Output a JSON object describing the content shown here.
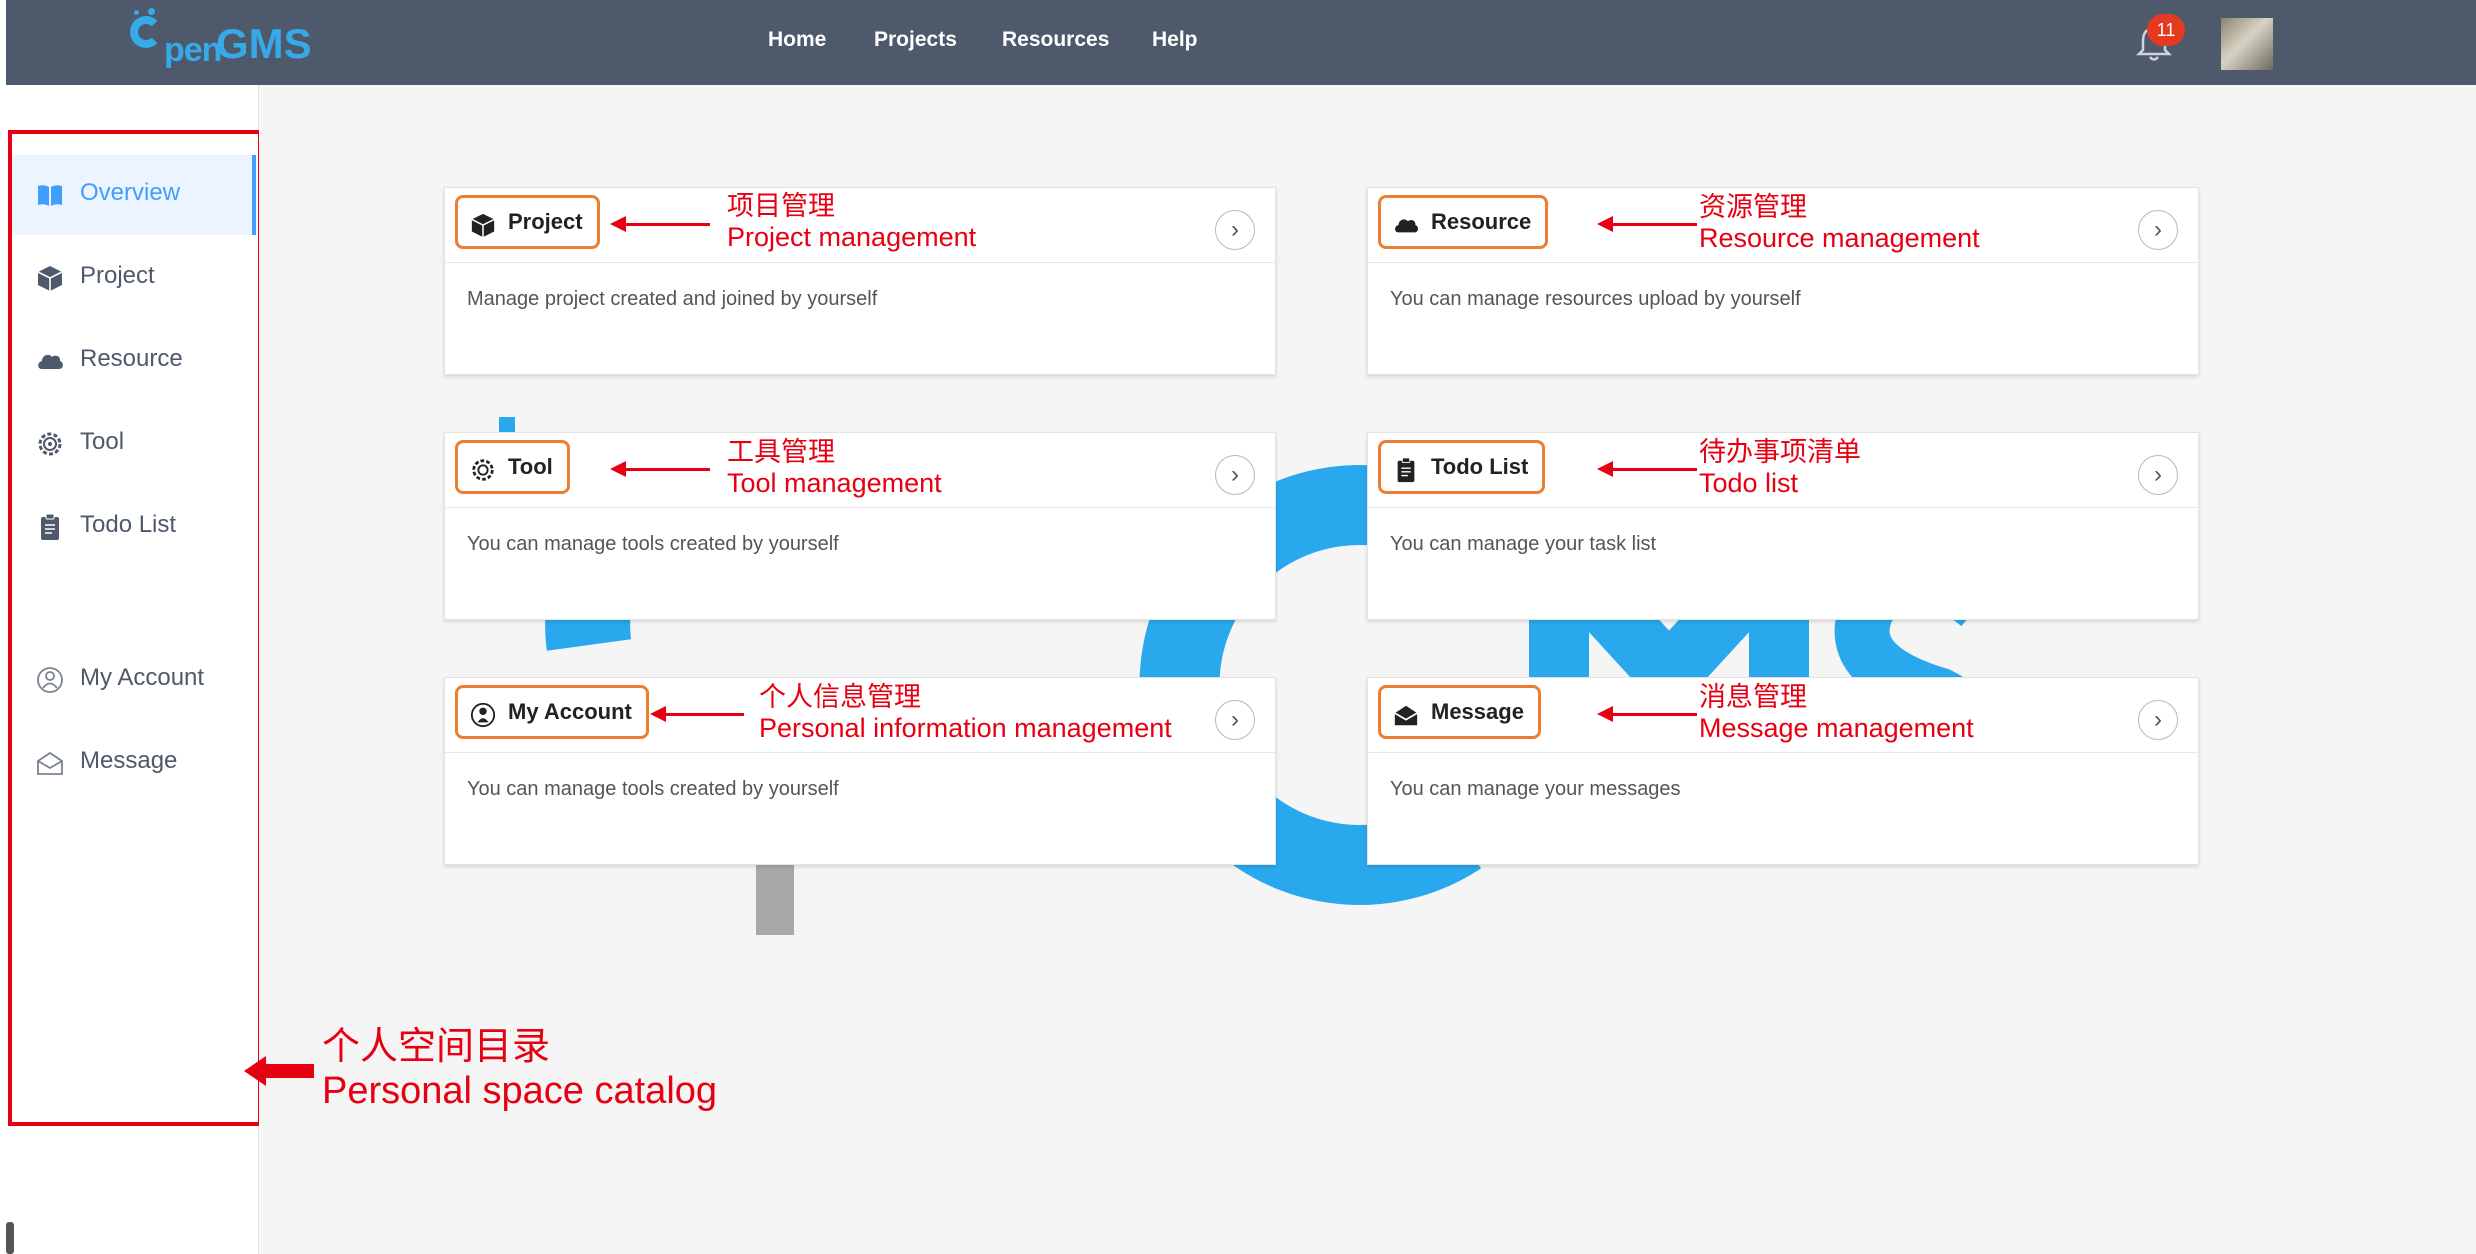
{
  "brand": {
    "logo_o": "O",
    "logo_pen": "pen",
    "logo_gms": "GMS",
    "accent": "#36a9e8"
  },
  "nav": {
    "links": [
      "Home",
      "Projects",
      "Resources",
      "Help"
    ],
    "notification_count": "11"
  },
  "sidebar": {
    "items": [
      {
        "label": "Overview",
        "icon": "book-icon",
        "active": true
      },
      {
        "label": "Project",
        "icon": "cube-icon"
      },
      {
        "label": "Resource",
        "icon": "cloud-icon"
      },
      {
        "label": "Tool",
        "icon": "gear-icon"
      },
      {
        "label": "Todo List",
        "icon": "clipboard-icon"
      },
      {
        "label": "My Account",
        "icon": "user-icon"
      },
      {
        "label": "Message",
        "icon": "envelope-icon"
      }
    ],
    "annotation_cn": "个人空间目录",
    "annotation_en": "Personal space catalog"
  },
  "cards": [
    {
      "title": "Project",
      "icon": "cube-icon",
      "desc": "Manage project created and joined by yourself",
      "note_cn": "项目管理",
      "note_en": "Project management"
    },
    {
      "title": "Resource",
      "icon": "cloud-icon",
      "desc": "You can manage resources upload by yourself",
      "note_cn": "资源管理",
      "note_en": "Resource management"
    },
    {
      "title": "Tool",
      "icon": "gear-icon",
      "desc": "You can manage tools created by yourself",
      "note_cn": "工具管理",
      "note_en": "Tool management"
    },
    {
      "title": "Todo List",
      "icon": "clipboard-icon",
      "desc": "You can manage your task list",
      "note_cn": "待办事项清单",
      "note_en": "Todo list"
    },
    {
      "title": "My Account",
      "icon": "user-icon",
      "desc": "You can manage tools created by yourself",
      "note_cn": "个人信息管理",
      "note_en": "Personal information management"
    },
    {
      "title": "Message",
      "icon": "envelope-icon",
      "desc": "You can manage your messages",
      "note_cn": "消息管理",
      "note_en": "Message management"
    }
  ],
  "colors": {
    "navbar": "#4f596c",
    "active": "#409eff",
    "annotation": "#e60012",
    "highlight": "#ed7d31"
  }
}
